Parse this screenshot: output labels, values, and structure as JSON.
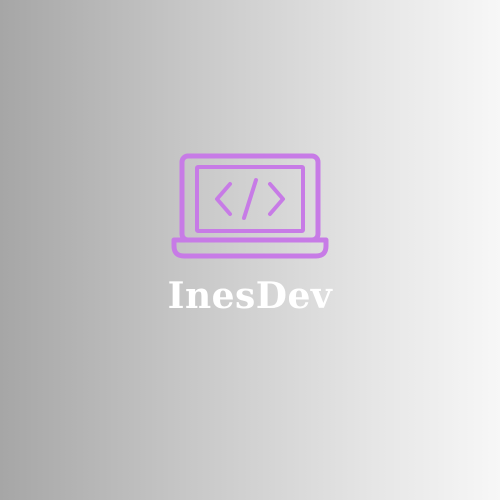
{
  "logo": {
    "icon": "laptop-code-icon",
    "accent_color": "#c77be6",
    "text_color": "#ffffff",
    "brand_name": "InesDev"
  }
}
